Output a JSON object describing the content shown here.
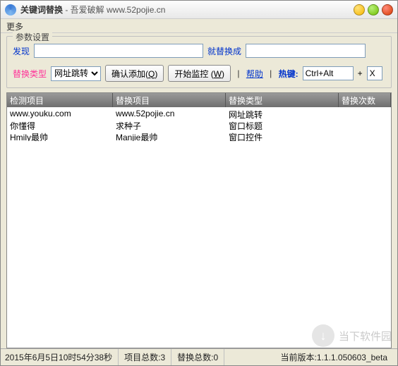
{
  "title": {
    "main": "关键词替换",
    "sub": " - 吾爱破解 www.52pojie.cn"
  },
  "menu": {
    "more": "更多"
  },
  "panel": {
    "legend": "参数设置",
    "find_label": "发现",
    "replace_label": "就替换成",
    "find_value": "",
    "replace_value": "",
    "type_label": "替换类型",
    "type_options": [
      "网址跳转",
      "窗口标题",
      "窗口控件"
    ],
    "type_selected": "网址跳转",
    "btn_confirm": "确认添加(",
    "btn_confirm_u": "Q",
    "btn_confirm_end": ")",
    "btn_start": "开始监控 (",
    "btn_start_u": "W",
    "btn_start_end": ")",
    "help": "帮助",
    "sep_bar": " | ",
    "hotkey_label": "热键:",
    "hotkey_value": "Ctrl+Alt",
    "plus": "+",
    "hotkey_key": "X"
  },
  "columns": {
    "c1": "检测项目",
    "c2": "替换项目",
    "c3": "替换类型",
    "c4": "替换次数"
  },
  "rows": [
    {
      "c1": "www.youku.com",
      "c2": "www.52pojie.cn",
      "c3": "网址跳转",
      "c4": ""
    },
    {
      "c1": "你懂得",
      "c2": "求种子",
      "c3": "窗口标题",
      "c4": ""
    },
    {
      "c1": "Hmily最帅",
      "c2": "Manjie最帅",
      "c3": "窗口控件",
      "c4": ""
    }
  ],
  "status": {
    "time": "2015年6月5日10时54分38秒",
    "proj_label": "项目总数:",
    "proj_count": "3",
    "rep_label": "替换总数:",
    "rep_count": "0",
    "ver_label": "当前版本:",
    "ver_value": "1.1.1.050603_beta"
  },
  "watermark": "当下软件园"
}
